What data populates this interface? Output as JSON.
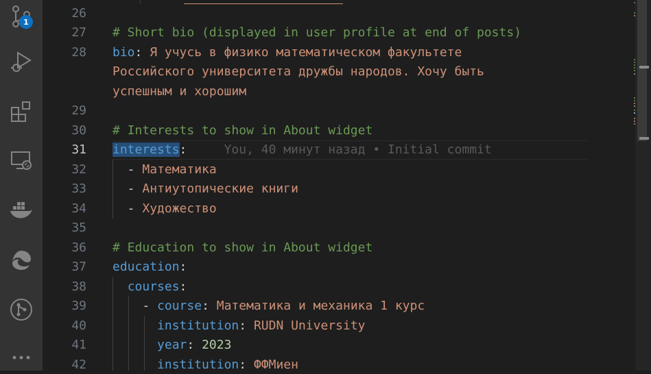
{
  "activity_bar": {
    "items": [
      {
        "name": "source-control-icon",
        "badge": "1"
      },
      {
        "name": "run-debug-icon"
      },
      {
        "name": "extensions-icon"
      },
      {
        "name": "remote-explorer-icon"
      },
      {
        "name": "docker-icon"
      },
      {
        "name": "edge-devtools-icon"
      },
      {
        "name": "git-graph-icon"
      },
      {
        "name": "more-icon"
      }
    ]
  },
  "editor": {
    "line_numbers": [
      "26",
      "27",
      "28",
      "29",
      "30",
      "31",
      "32",
      "33",
      "34",
      "35",
      "36",
      "37",
      "38",
      "39",
      "40",
      "41",
      "42"
    ],
    "lines": {
      "l27_comment": "# Short bio (displayed in user profile at end of posts)",
      "l28_key": "bio",
      "l28_value_1": "Я учусь в физико математическом факультете",
      "l28_value_2": "Российского университета дружбы народов. Хочу быть",
      "l28_value_3": "успешным и хорошим",
      "l30_comment": "# Interests to show in About widget",
      "l31_key": "interests",
      "l31_blame": "You, 40 минут назад • Initial commit",
      "l32_item": "Математика",
      "l33_item": "Антиутопические книги",
      "l34_item": "Художество",
      "l36_comment": "# Education to show in About widget",
      "l37_key": "education",
      "l38_key": "courses",
      "l39_key": "course",
      "l39_value": "Математика и механика 1 курс",
      "l40_key": "institution",
      "l40_value": "RUDN University",
      "l41_key": "year",
      "l41_value": "2023",
      "l42_key": "institution",
      "l42_value": "ФФМиен"
    }
  },
  "colors": {
    "background": "#1e1e1e",
    "activity_bar": "#333333",
    "comment": "#6a9955",
    "key": "#569cd6",
    "string": "#ce9178",
    "number": "#b5cea8",
    "badge": "#0e70c0"
  }
}
